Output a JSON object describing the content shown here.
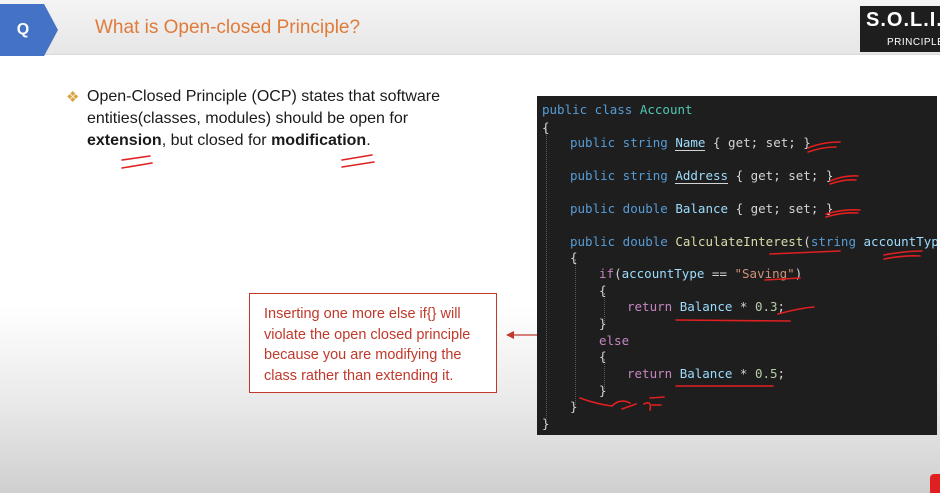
{
  "header": {
    "badge": "Q",
    "title": "What is Open-closed Principle?",
    "brand_main": "S.O.L.I.D",
    "brand_sub": "PRINCIPLES"
  },
  "bullet": {
    "icon": "diamond-bullet-icon",
    "text_1": "Open-Closed Principle (OCP) states that software entities(classes, modules) should be open for ",
    "bold_1": "extension",
    "text_2": ", but closed for ",
    "bold_2": "modification",
    "text_3": "."
  },
  "code": {
    "l1_kw": "public class ",
    "l1_ty": "Account",
    "l2": "{",
    "l3_kw": "public string ",
    "l3_name": "Name",
    "l3_rest": " { get; set; }",
    "l4_kw": "public string ",
    "l4_name": "Address",
    "l4_rest": " { get; set; }",
    "l5_kw": "public double ",
    "l5_name": "Balance",
    "l5_rest": " { get; set; }",
    "l6_kw": "public double ",
    "l6_fn": "CalculateInterest",
    "l6_open": "(",
    "l6_ptype": "string ",
    "l6_param": "accountType",
    "l6_close": ")",
    "l7": "{",
    "l8_if": "if",
    "l8_open": "(",
    "l8_var": "accountType",
    "l8_op": " == ",
    "l8_str": "\"Saving\"",
    "l8_close": ")",
    "l9": "{",
    "l10_ret": "return ",
    "l10_var": "Balance",
    "l10_op": " * ",
    "l10_num": "0.3",
    "l10_end": ";",
    "l11": "}",
    "l12_else": "else",
    "l13": "{",
    "l14_ret": "return ",
    "l14_var": "Balance",
    "l14_op": " * ",
    "l14_num": "0.5",
    "l14_end": ";",
    "l15": "}",
    "l16": "}",
    "l17": "}"
  },
  "callout": {
    "text": "Inserting one more else if{} will violate the open closed principle because you are modifying the class rather than extending it."
  },
  "colors": {
    "title": "#e07b39",
    "badge": "#4472c4",
    "annotation": "#e02020",
    "code_bg": "#1e1e1e"
  }
}
